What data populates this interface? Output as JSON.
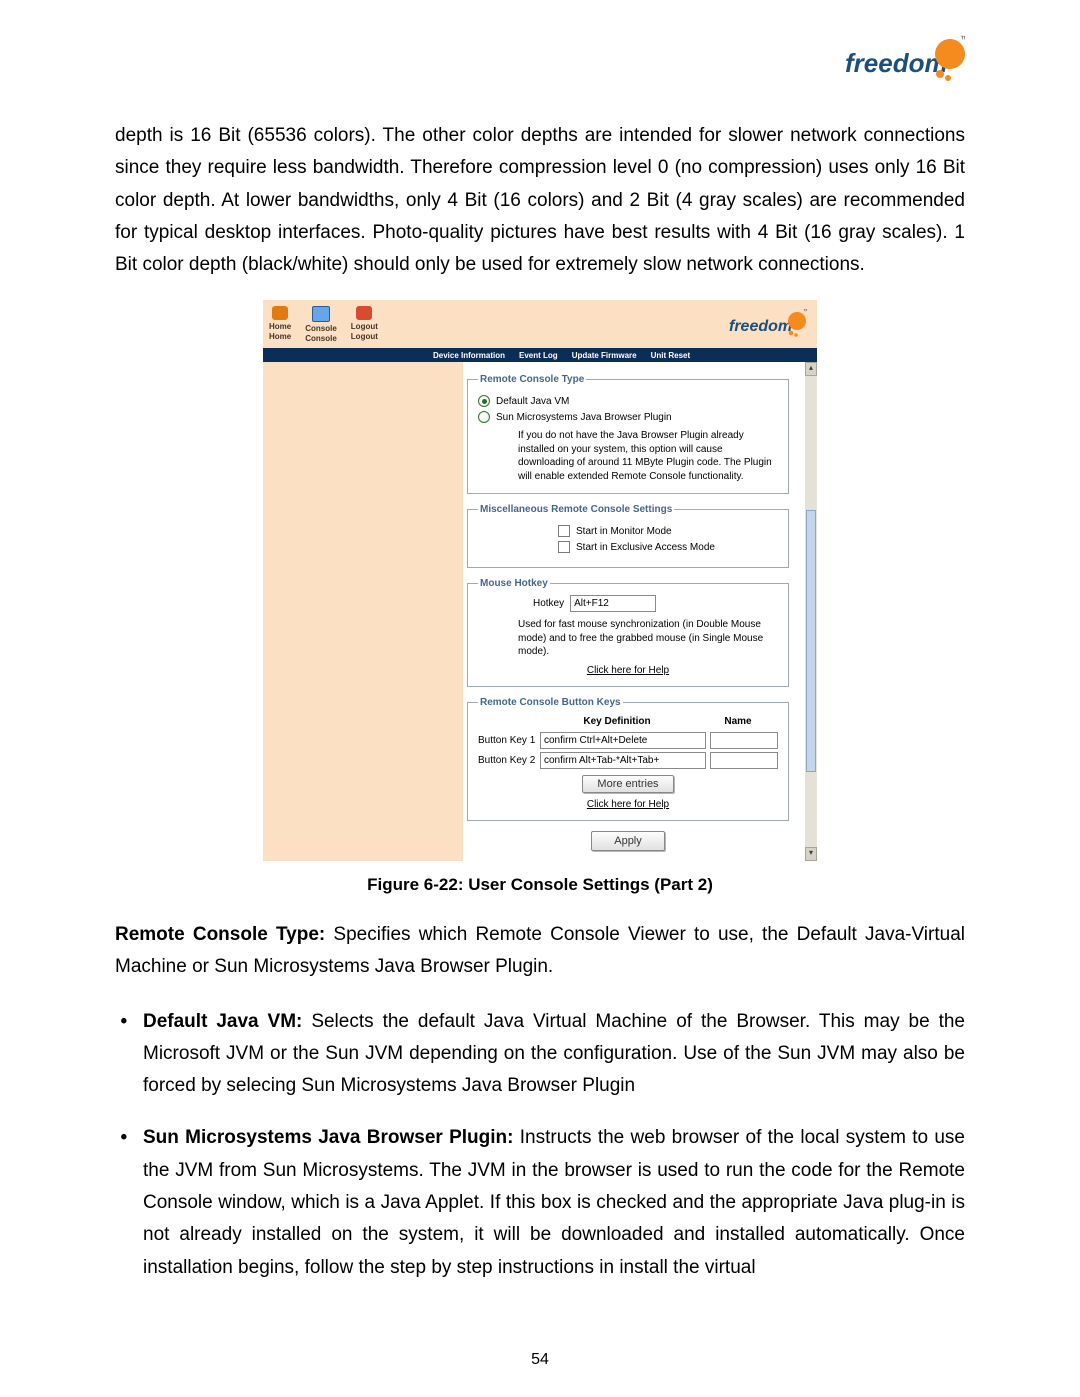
{
  "logo": {
    "text": "freedom",
    "tm": "™"
  },
  "intro_paragraph": "depth is 16 Bit (65536 colors). The other color depths are intended for slower network connections since they require less bandwidth. Therefore compression level 0 (no compression) uses only 16 Bit color depth. At lower bandwidths, only 4 Bit (16 colors) and 2 Bit (4 gray scales) are recommended for typical desktop interfaces. Photo-quality pictures have best results with 4 Bit (16 gray scales). 1 Bit color depth (black/white) should only be used for extremely slow network connections.",
  "screenshot": {
    "nav": {
      "home": {
        "small": "Home",
        "label": "Home"
      },
      "console": {
        "small": "Console",
        "label": "Console"
      },
      "logout": {
        "small": "Logout",
        "label": "Logout"
      }
    },
    "menu": {
      "device_information": "Device Information",
      "event_log": "Event Log",
      "update_firmware": "Update Firmware",
      "unit_reset": "Unit Reset"
    },
    "remote_console_type": {
      "legend": "Remote Console Type",
      "default_vm": "Default Java VM",
      "sun_plugin": "Sun Microsystems Java Browser Plugin",
      "note": "If you do not have the Java Browser Plugin already installed on your system, this option will cause downloading of around 11 MByte Plugin code. The Plugin will enable extended Remote Console functionality."
    },
    "misc": {
      "legend": "Miscellaneous Remote Console Settings",
      "monitor": "Start in Monitor Mode",
      "exclusive": "Start in Exclusive Access Mode"
    },
    "mouse_hotkey": {
      "legend": "Mouse Hotkey",
      "hotkey_label": "Hotkey",
      "hotkey_value": "Alt+F12",
      "note": "Used for fast mouse synchronization (in Double Mouse mode) and to free the grabbed mouse (in Single Mouse mode).",
      "help": "Click here for Help"
    },
    "button_keys": {
      "legend": "Remote Console Button Keys",
      "col_key": "Key Definition",
      "col_name": "Name",
      "row1_label": "Button Key 1",
      "row1_value": "confirm Ctrl+Alt+Delete",
      "row2_label": "Button Key 2",
      "row2_value": "confirm Alt+Tab-*Alt+Tab+",
      "more_entries": "More entries",
      "help": "Click here for Help"
    },
    "apply": "Apply"
  },
  "caption": "Figure 6-22: User Console Settings (Part 2)",
  "rct_heading": "Remote Console Type:",
  "rct_text": " Specifies which Remote Console Viewer to use, the Default Java-Virtual Machine or Sun Microsystems Java Browser Plugin.",
  "list": {
    "item1_bold": "Default Java VM:",
    "item1_text": " Selects the default Java Virtual Machine of the Browser. This may be the Microsoft JVM or the Sun JVM depending on the configuration. Use of the Sun JVM may also be forced by selecing Sun Microsystems Java Browser Plugin",
    "item2_bold": "Sun Microsystems Java Browser Plugin:",
    "item2_text": " Instructs the web browser of the local system to use the JVM from Sun Microsystems. The JVM in the browser is used to run the code for the Remote Console window, which is a Java Applet. If this box is checked and the appropriate Java plug-in is not already installed on the system, it will be downloaded and installed automatically. Once installation begins, follow the step by step instructions in install the virtual"
  },
  "page_number": "54"
}
